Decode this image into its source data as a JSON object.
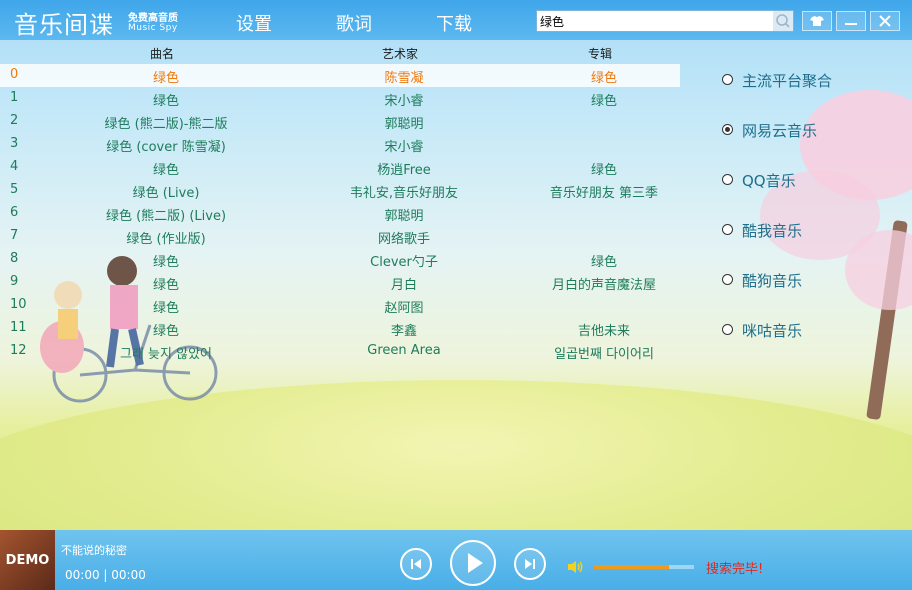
{
  "app": {
    "logo": "音乐间谍",
    "logo_sub_cn": "免费高音质",
    "logo_sub_en": "Music Spy"
  },
  "nav": [
    {
      "label": "设置"
    },
    {
      "label": "歌词"
    },
    {
      "label": "下载"
    }
  ],
  "search": {
    "value": "绿色"
  },
  "table": {
    "columns": [
      "曲名",
      "艺术家",
      "专辑"
    ],
    "selected_index": 0,
    "rows": [
      {
        "idx": "0",
        "title": "绿色",
        "artist": "陈雪凝",
        "album": "绿色"
      },
      {
        "idx": "1",
        "title": "绿色",
        "artist": "宋小睿",
        "album": "绿色"
      },
      {
        "idx": "2",
        "title": "绿色 (熊二版)-熊二版",
        "artist": "郭聪明",
        "album": ""
      },
      {
        "idx": "3",
        "title": "绿色 (cover 陈雪凝)",
        "artist": "宋小睿",
        "album": ""
      },
      {
        "idx": "4",
        "title": "绿色",
        "artist": "杨逍Free",
        "album": "绿色"
      },
      {
        "idx": "5",
        "title": "绿色 (Live)",
        "artist": "韦礼安,音乐好朋友",
        "album": "音乐好朋友 第三季"
      },
      {
        "idx": "6",
        "title": "绿色 (熊二版) (Live)",
        "artist": "郭聪明",
        "album": ""
      },
      {
        "idx": "7",
        "title": "绿色 (作业版)",
        "artist": "网络歌手",
        "album": ""
      },
      {
        "idx": "8",
        "title": "绿色",
        "artist": "Clever勺子",
        "album": "绿色"
      },
      {
        "idx": "9",
        "title": "绿色",
        "artist": "月白",
        "album": "月白的声音魔法屋"
      },
      {
        "idx": "10",
        "title": "绿色",
        "artist": "赵阿图",
        "album": ""
      },
      {
        "idx": "11",
        "title": "绿色",
        "artist": "李鑫",
        "album": "吉他未来"
      },
      {
        "idx": "12",
        "title": "그래 늦지 않았어",
        "artist": "Green Area",
        "album": "일곱번째 다이어리"
      }
    ]
  },
  "platforms": [
    {
      "label": "主流平台聚合",
      "checked": false
    },
    {
      "label": "网易云音乐",
      "checked": true
    },
    {
      "label": "QQ音乐",
      "checked": false
    },
    {
      "label": "酷我音乐",
      "checked": false
    },
    {
      "label": "酷狗音乐",
      "checked": false
    },
    {
      "label": "咪咕音乐",
      "checked": false
    }
  ],
  "player": {
    "cover_text": "DEMO",
    "song_title": "不能说的秘密",
    "time": "00:00 | 00:00",
    "volume_fraction": 0.75,
    "status": "搜索完毕!"
  },
  "colors": {
    "accent": "#3fa6ea",
    "selected_row_text": "#f07a10",
    "row_text": "#1e7c5b",
    "status_text": "#e8261c"
  },
  "icons": [
    "search-icon",
    "skin-icon",
    "minimize-icon",
    "close-icon",
    "previous-icon",
    "play-icon",
    "next-icon",
    "volume-icon"
  ]
}
